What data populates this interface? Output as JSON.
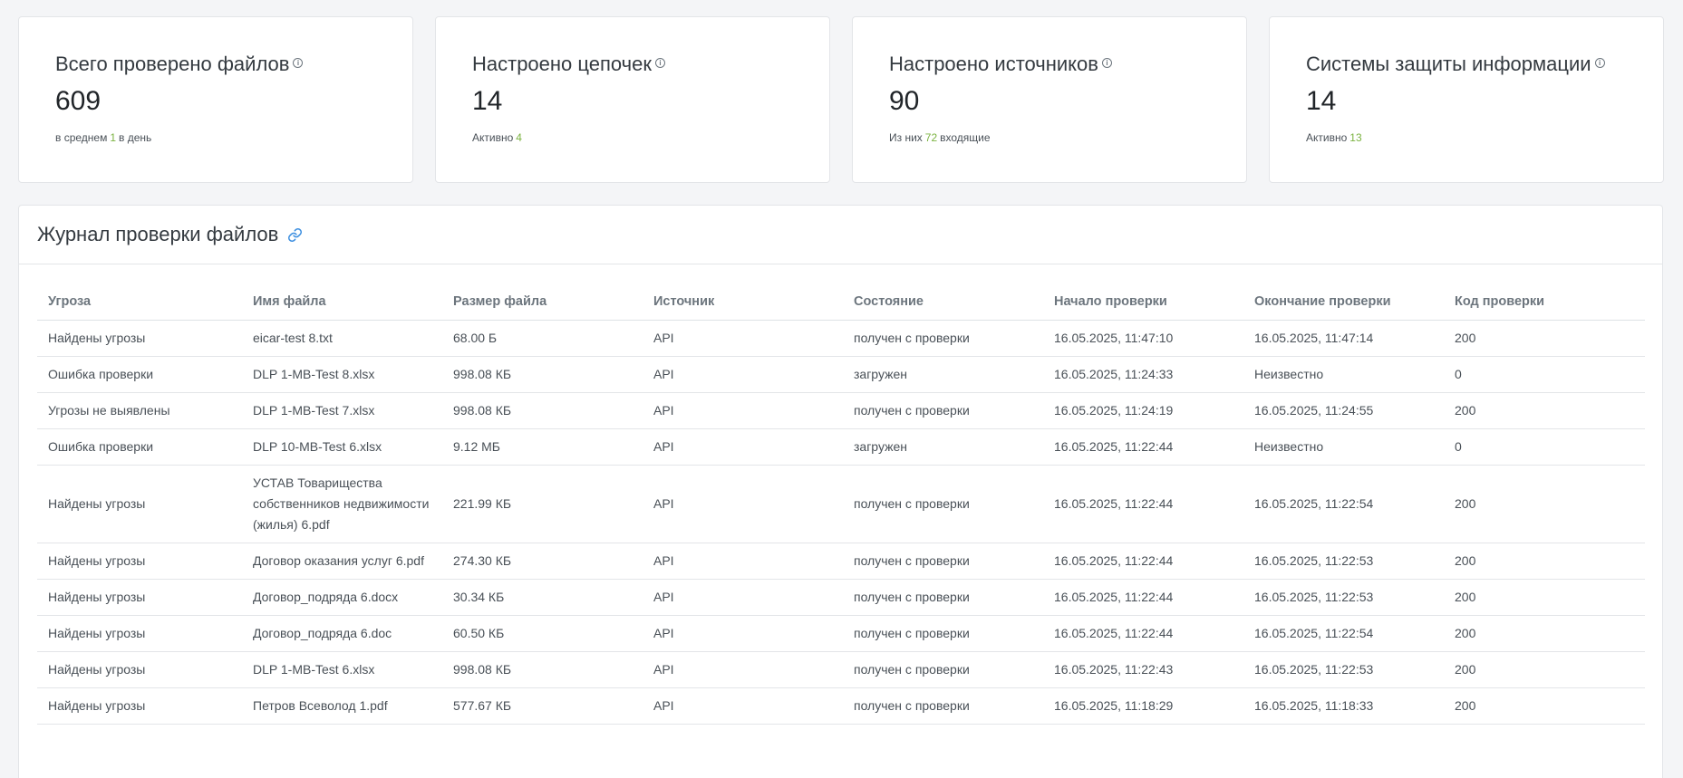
{
  "stats": [
    {
      "title": "Всего проверено файлов",
      "value": "609",
      "sub_pre": "в среднем",
      "sub_accent": "1",
      "sub_post": "в день"
    },
    {
      "title": "Настроено цепочек",
      "value": "14",
      "sub_pre": "Активно",
      "sub_accent": "4",
      "sub_post": ""
    },
    {
      "title": "Настроено источников",
      "value": "90",
      "sub_pre": "Из них",
      "sub_accent": "72",
      "sub_post": "входящие"
    },
    {
      "title": "Системы защиты информации",
      "value": "14",
      "sub_pre": "Активно",
      "sub_accent": "13",
      "sub_post": ""
    }
  ],
  "journal": {
    "title": "Журнал проверки файлов",
    "columns": [
      "Угроза",
      "Имя файла",
      "Размер файла",
      "Источник",
      "Состояние",
      "Начало проверки",
      "Окончание проверки",
      "Код проверки"
    ],
    "rows": [
      [
        "Найдены угрозы",
        "eicar-test 8.txt",
        "68.00 Б",
        "API",
        "получен с проверки",
        "16.05.2025, 11:47:10",
        "16.05.2025, 11:47:14",
        "200"
      ],
      [
        "Ошибка проверки",
        "DLP 1-MB-Test 8.xlsx",
        "998.08 КБ",
        "API",
        "загружен",
        "16.05.2025, 11:24:33",
        "Неизвестно",
        "0"
      ],
      [
        "Угрозы не выявлены",
        "DLP 1-MB-Test 7.xlsx",
        "998.08 КБ",
        "API",
        "получен с проверки",
        "16.05.2025, 11:24:19",
        "16.05.2025, 11:24:55",
        "200"
      ],
      [
        "Ошибка проверки",
        "DLP 10-MB-Test 6.xlsx",
        "9.12 МБ",
        "API",
        "загружен",
        "16.05.2025, 11:22:44",
        "Неизвестно",
        "0"
      ],
      [
        "Найдены угрозы",
        "УСТАВ Товарищества собственников недвижимости (жилья) 6.pdf",
        "221.99 КБ",
        "API",
        "получен с проверки",
        "16.05.2025, 11:22:44",
        "16.05.2025, 11:22:54",
        "200"
      ],
      [
        "Найдены угрозы",
        "Договор оказания услуг 6.pdf",
        "274.30 КБ",
        "API",
        "получен с проверки",
        "16.05.2025, 11:22:44",
        "16.05.2025, 11:22:53",
        "200"
      ],
      [
        "Найдены угрозы",
        "Договор_подряда 6.docx",
        "30.34 КБ",
        "API",
        "получен с проверки",
        "16.05.2025, 11:22:44",
        "16.05.2025, 11:22:53",
        "200"
      ],
      [
        "Найдены угрозы",
        "Договор_подряда 6.doc",
        "60.50 КБ",
        "API",
        "получен с проверки",
        "16.05.2025, 11:22:44",
        "16.05.2025, 11:22:54",
        "200"
      ],
      [
        "Найдены угрозы",
        "DLP 1-MB-Test 6.xlsx",
        "998.08 КБ",
        "API",
        "получен с проверки",
        "16.05.2025, 11:22:43",
        "16.05.2025, 11:22:53",
        "200"
      ],
      [
        "Найдены угрозы",
        "Петров Всеволод 1.pdf",
        "577.67 КБ",
        "API",
        "получен с проверки",
        "16.05.2025, 11:18:29",
        "16.05.2025, 11:18:33",
        "200"
      ]
    ]
  },
  "colors": {
    "accent_green": "#7cb342",
    "link_blue": "#3d8fe0"
  },
  "icons": {
    "info": "info-circle-icon",
    "link": "link-icon"
  }
}
